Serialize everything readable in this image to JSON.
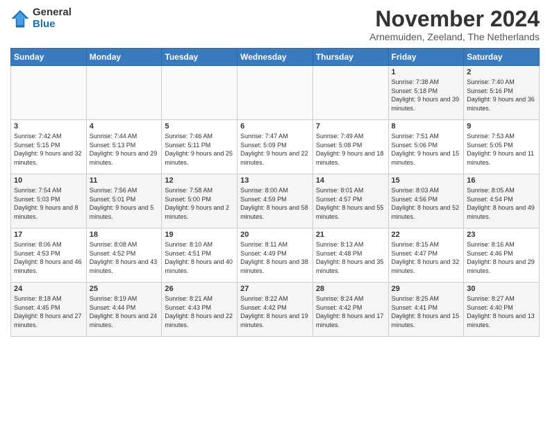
{
  "header": {
    "logo_general": "General",
    "logo_blue": "Blue",
    "month_title": "November 2024",
    "subtitle": "Arnemuiden, Zeeland, The Netherlands"
  },
  "weekdays": [
    "Sunday",
    "Monday",
    "Tuesday",
    "Wednesday",
    "Thursday",
    "Friday",
    "Saturday"
  ],
  "weeks": [
    [
      {
        "day": "",
        "info": ""
      },
      {
        "day": "",
        "info": ""
      },
      {
        "day": "",
        "info": ""
      },
      {
        "day": "",
        "info": ""
      },
      {
        "day": "",
        "info": ""
      },
      {
        "day": "1",
        "info": "Sunrise: 7:38 AM\nSunset: 5:18 PM\nDaylight: 9 hours and 39 minutes."
      },
      {
        "day": "2",
        "info": "Sunrise: 7:40 AM\nSunset: 5:16 PM\nDaylight: 9 hours and 36 minutes."
      }
    ],
    [
      {
        "day": "3",
        "info": "Sunrise: 7:42 AM\nSunset: 5:15 PM\nDaylight: 9 hours and 32 minutes."
      },
      {
        "day": "4",
        "info": "Sunrise: 7:44 AM\nSunset: 5:13 PM\nDaylight: 9 hours and 29 minutes."
      },
      {
        "day": "5",
        "info": "Sunrise: 7:46 AM\nSunset: 5:11 PM\nDaylight: 9 hours and 25 minutes."
      },
      {
        "day": "6",
        "info": "Sunrise: 7:47 AM\nSunset: 5:09 PM\nDaylight: 9 hours and 22 minutes."
      },
      {
        "day": "7",
        "info": "Sunrise: 7:49 AM\nSunset: 5:08 PM\nDaylight: 9 hours and 18 minutes."
      },
      {
        "day": "8",
        "info": "Sunrise: 7:51 AM\nSunset: 5:06 PM\nDaylight: 9 hours and 15 minutes."
      },
      {
        "day": "9",
        "info": "Sunrise: 7:53 AM\nSunset: 5:05 PM\nDaylight: 9 hours and 11 minutes."
      }
    ],
    [
      {
        "day": "10",
        "info": "Sunrise: 7:54 AM\nSunset: 5:03 PM\nDaylight: 9 hours and 8 minutes."
      },
      {
        "day": "11",
        "info": "Sunrise: 7:56 AM\nSunset: 5:01 PM\nDaylight: 9 hours and 5 minutes."
      },
      {
        "day": "12",
        "info": "Sunrise: 7:58 AM\nSunset: 5:00 PM\nDaylight: 9 hours and 2 minutes."
      },
      {
        "day": "13",
        "info": "Sunrise: 8:00 AM\nSunset: 4:59 PM\nDaylight: 8 hours and 58 minutes."
      },
      {
        "day": "14",
        "info": "Sunrise: 8:01 AM\nSunset: 4:57 PM\nDaylight: 8 hours and 55 minutes."
      },
      {
        "day": "15",
        "info": "Sunrise: 8:03 AM\nSunset: 4:56 PM\nDaylight: 8 hours and 52 minutes."
      },
      {
        "day": "16",
        "info": "Sunrise: 8:05 AM\nSunset: 4:54 PM\nDaylight: 8 hours and 49 minutes."
      }
    ],
    [
      {
        "day": "17",
        "info": "Sunrise: 8:06 AM\nSunset: 4:53 PM\nDaylight: 8 hours and 46 minutes."
      },
      {
        "day": "18",
        "info": "Sunrise: 8:08 AM\nSunset: 4:52 PM\nDaylight: 8 hours and 43 minutes."
      },
      {
        "day": "19",
        "info": "Sunrise: 8:10 AM\nSunset: 4:51 PM\nDaylight: 8 hours and 40 minutes."
      },
      {
        "day": "20",
        "info": "Sunrise: 8:11 AM\nSunset: 4:49 PM\nDaylight: 8 hours and 38 minutes."
      },
      {
        "day": "21",
        "info": "Sunrise: 8:13 AM\nSunset: 4:48 PM\nDaylight: 8 hours and 35 minutes."
      },
      {
        "day": "22",
        "info": "Sunrise: 8:15 AM\nSunset: 4:47 PM\nDaylight: 8 hours and 32 minutes."
      },
      {
        "day": "23",
        "info": "Sunrise: 8:16 AM\nSunset: 4:46 PM\nDaylight: 8 hours and 29 minutes."
      }
    ],
    [
      {
        "day": "24",
        "info": "Sunrise: 8:18 AM\nSunset: 4:45 PM\nDaylight: 8 hours and 27 minutes."
      },
      {
        "day": "25",
        "info": "Sunrise: 8:19 AM\nSunset: 4:44 PM\nDaylight: 8 hours and 24 minutes."
      },
      {
        "day": "26",
        "info": "Sunrise: 8:21 AM\nSunset: 4:43 PM\nDaylight: 8 hours and 22 minutes."
      },
      {
        "day": "27",
        "info": "Sunrise: 8:22 AM\nSunset: 4:42 PM\nDaylight: 8 hours and 19 minutes."
      },
      {
        "day": "28",
        "info": "Sunrise: 8:24 AM\nSunset: 4:42 PM\nDaylight: 8 hours and 17 minutes."
      },
      {
        "day": "29",
        "info": "Sunrise: 8:25 AM\nSunset: 4:41 PM\nDaylight: 8 hours and 15 minutes."
      },
      {
        "day": "30",
        "info": "Sunrise: 8:27 AM\nSunset: 4:40 PM\nDaylight: 8 hours and 13 minutes."
      }
    ]
  ]
}
